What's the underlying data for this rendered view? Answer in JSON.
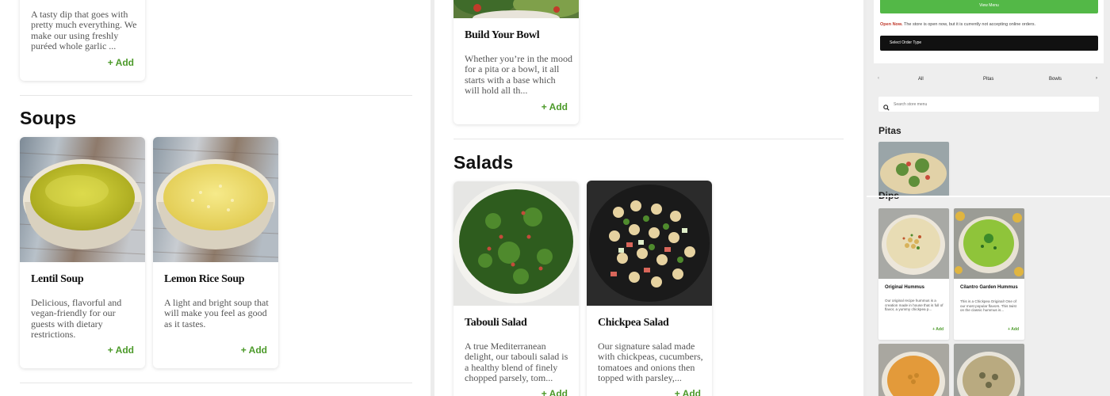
{
  "left": {
    "dip_card": {
      "desc": "A tasty dip that goes with pretty much everything. We make our using freshly puréed whole garlic ...",
      "add": "+ Add"
    },
    "soups_title": "Soups",
    "soups": [
      {
        "title": "Lentil Soup",
        "desc": "Delicious, flavorful and vegan-friendly for our guests with dietary restrictions.",
        "add": "+ Add"
      },
      {
        "title": "Lemon Rice Soup",
        "desc": "A light and bright soup that will make you feel as good as it tastes.",
        "add": "+ Add"
      }
    ]
  },
  "middle": {
    "bowl_card": {
      "title": "Build Your Bowl",
      "desc": "Whether you’re in the mood for a pita or a bowl, it all starts with a base which will hold all th...",
      "add": "+ Add"
    },
    "salads_title": "Salads",
    "salads": [
      {
        "title": "Tabouli Salad",
        "desc": "A true Mediterranean delight, our tabouli salad is a healthy blend of finely chopped parsely, tom...",
        "add": "+ Add"
      },
      {
        "title": "Chickpea Salad",
        "desc": "Our signature salad made with chickpeas, cucumbers, tomatoes and onions then topped with parsley,...",
        "add": "+ Add"
      }
    ]
  },
  "mobile": {
    "view_menu": "View Menu",
    "open_now": "Open Now.",
    "open_msg": "The store is open now, but it is currently not accepting online orders.",
    "select_order_type": "Select Order Type",
    "tabs": [
      "All",
      "Pitas",
      "Bowls"
    ],
    "search_placeholder": "Search store menu",
    "pitas_heading": "Pitas",
    "dips_heading": "Dips",
    "dips": [
      {
        "title": "Original Hummus",
        "desc": "Our original recipe hummus is a creation made in house that is full of flavor, a yummy chickpea p...",
        "add": "+ Add"
      },
      {
        "title": "Cilantro Garden Hummus",
        "desc": "This is a Chickpea Original! One of our most popular flavors. This twist on the classic hummus is...",
        "add": "+ Add"
      }
    ]
  },
  "colors": {
    "accent_green": "#4c9a2a",
    "button_green": "#53b847",
    "open_red": "#c0392b"
  }
}
